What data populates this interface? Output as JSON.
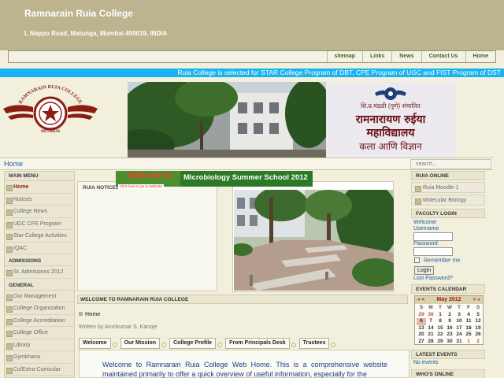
{
  "header": {
    "title": "Ramnarain Ruia College",
    "address": "L Nappo Road, Matunga, Mumbai 400019, INDIA"
  },
  "topnav": [
    "sitemap",
    "Links",
    "News",
    "Contact Us",
    "Home"
  ],
  "marquee": "Ruia College is selected for STAR College Program of DBT, CPE Program of UGC and FIST Program of DST",
  "logo": {
    "text_top": "RAMNARAIN RUIA COLLEGE",
    "text_bottom": "MUMBAI"
  },
  "banner": {
    "line1": "शि.प्र.मंडळी (पुणे) संचालित",
    "line2": "रामनारायण रुईया",
    "line3": "महाविद्यालय",
    "line4": "कला आणि विज्ञान"
  },
  "homebar": {
    "home_label": "Home",
    "search_placeholder": "search..."
  },
  "left_menu": {
    "main_menu": "MAIN MENU",
    "main_items": [
      "Home",
      "Notices",
      "College News",
      "UGC CPE Program",
      "Star College Activities",
      "IQAC"
    ],
    "admissions": "ADMISSIONS",
    "admission_items": [
      "Sr. Admissions 2012"
    ],
    "general": "GENERAL",
    "general_items": [
      "Our Management",
      "College Organization",
      "College Accreditation",
      "College Office",
      "Library",
      "Gymkhana",
      "Co/Extra-Curricular"
    ]
  },
  "notices": {
    "title": "RUIA NOTICES"
  },
  "ribbon": {
    "welcome": "Welcome to",
    "title": "Microbiology Summer School 2012",
    "click": "Click here to go to Website"
  },
  "welcome_section": {
    "title": "WELCOME TO RAMNARAIN RUIA COLLEGE",
    "breadcrumb": "Home",
    "written_by": "Written by Arunkumar S. Kanoje",
    "tabs": [
      "Welcome",
      "Our Mission",
      "College Profile",
      "From Principals Desk",
      "Trustees"
    ],
    "intro": "Welcome to Ramnarain Ruia College Web Home. This is a comprehensive website maintained primarily to offer a quick overview of useful information, especially for the"
  },
  "right_col": {
    "online": "RUIA ONLINE",
    "online_items": [
      "Ruia Moodle-1",
      "Molecular Biology"
    ],
    "login_title": "FACULTY LOGIN",
    "welcome": "Welcome",
    "username": "Username",
    "password": "Password",
    "remember": "Remember me",
    "login_button": "Login",
    "lost_password": "Lost Password?",
    "events_calendar": "EVENTS CALENDAR",
    "latest_events": "LATEST EVENTS",
    "no_events": "No events",
    "whos_online": "WHO'S ONLINE"
  },
  "calendar": {
    "prev": "« <",
    "next": "> »",
    "month": "May 2012",
    "days_of_week": [
      "S",
      "M",
      "T",
      "W",
      "T",
      "F",
      "S"
    ],
    "weeks": [
      [
        "29",
        "30",
        "1",
        "2",
        "3",
        "4",
        "5"
      ],
      [
        "6",
        "7",
        "8",
        "9",
        "10",
        "11",
        "12"
      ],
      [
        "13",
        "14",
        "15",
        "16",
        "17",
        "18",
        "19"
      ],
      [
        "20",
        "21",
        "22",
        "23",
        "24",
        "25",
        "26"
      ],
      [
        "27",
        "28",
        "29",
        "30",
        "31",
        "1",
        "2"
      ]
    ],
    "today": "6"
  }
}
